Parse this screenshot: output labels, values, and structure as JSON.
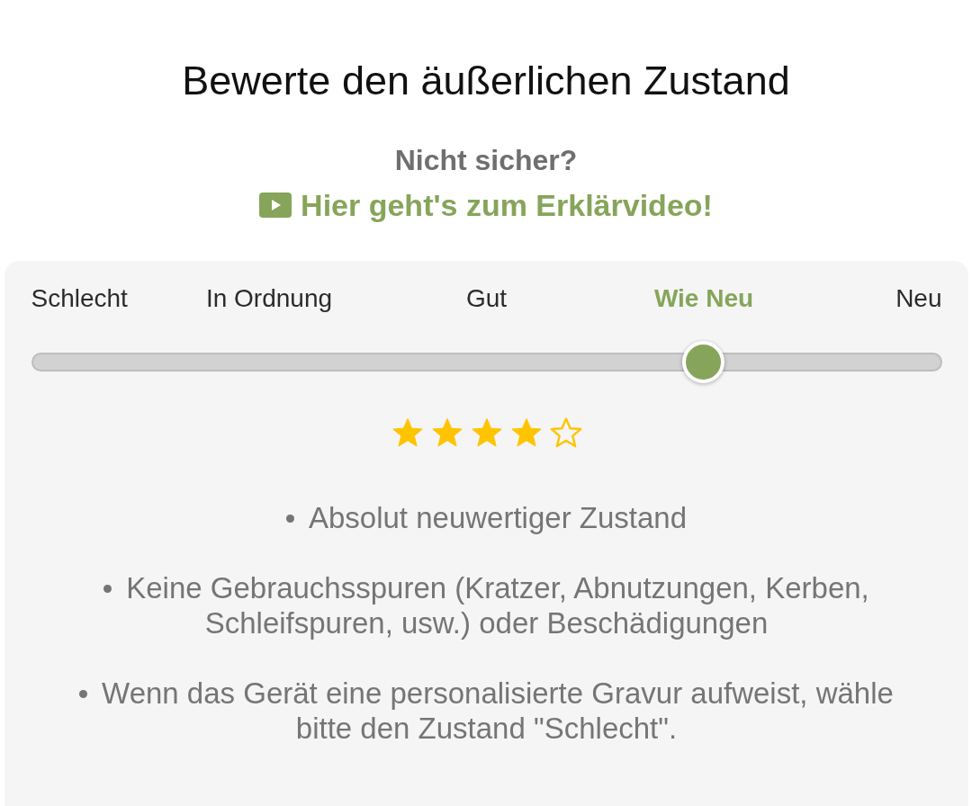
{
  "title": "Bewerte den äußerlichen Zustand",
  "help": {
    "question": "Nicht sicher?",
    "link": "Hier geht's zum Erklärvideo!"
  },
  "rating": {
    "labels": [
      {
        "label": "Schlecht",
        "selected": false
      },
      {
        "label": "In Ordnung",
        "selected": false
      },
      {
        "label": "Gut",
        "selected": false
      },
      {
        "label": "Wie Neu",
        "selected": true
      },
      {
        "label": "Neu",
        "selected": false
      }
    ],
    "slider": {
      "level": 0.75
    },
    "stars": 4,
    "features": [
      "Absolut neuwertiger Zustand",
      "Keine Gebrauchsspuren (Kratzer, Abnutzungen, Kerben, Schleifspuren, usw.) oder Beschädigungen",
      "Wenn das Gerät eine personalisierte Gravur aufweist, wähle bitte den Zustand \"Schlecht\"."
    ]
  }
}
